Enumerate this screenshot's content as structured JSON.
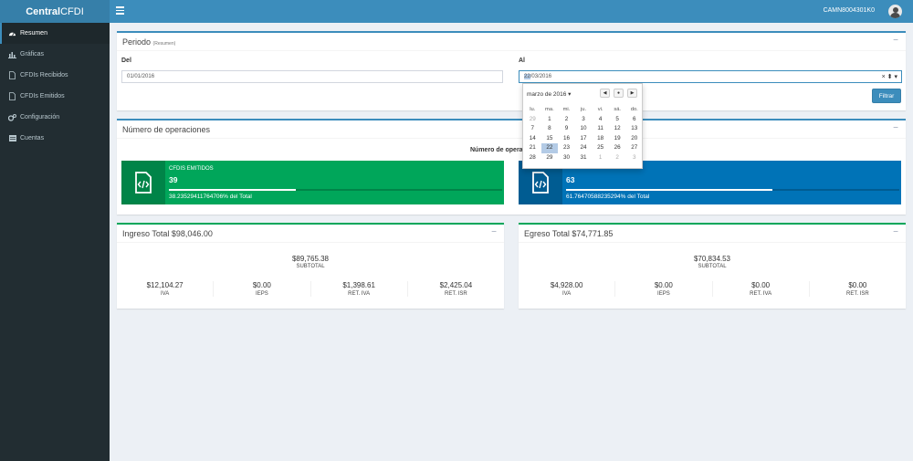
{
  "app": {
    "logo_bold": "Central",
    "logo_rest": "CFDI",
    "user": "CAMN8004301K0"
  },
  "sidebar": {
    "items": [
      {
        "label": "Resumen",
        "icon": "dashboard-icon"
      },
      {
        "label": "Gráficas",
        "icon": "bar-chart-icon"
      },
      {
        "label": "CFDIs Recibidos",
        "icon": "file-icon"
      },
      {
        "label": "CFDIs Emitidos",
        "icon": "file-icon"
      },
      {
        "label": "Configuración",
        "icon": "gears-icon"
      },
      {
        "label": "Cuentas",
        "icon": "list-icon"
      }
    ]
  },
  "periodo": {
    "title": "Periodo",
    "subtitle": "(Resumen)",
    "del_label": "Del",
    "del_value": "01/01/2016",
    "al_label": "Al",
    "al_day": "22",
    "al_rest": "/03/2016",
    "filter_button": "Filtrar"
  },
  "datepicker": {
    "month_label": "marzo de 2016 ▾",
    "weekdays": [
      "lu.",
      "ma.",
      "mi.",
      "ju.",
      "vi.",
      "sá.",
      "do."
    ],
    "weeks": [
      [
        "29",
        "1",
        "2",
        "3",
        "4",
        "5",
        "6"
      ],
      [
        "7",
        "8",
        "9",
        "10",
        "11",
        "12",
        "13"
      ],
      [
        "14",
        "15",
        "16",
        "17",
        "18",
        "19",
        "20"
      ],
      [
        "21",
        "22",
        "23",
        "24",
        "25",
        "26",
        "27"
      ],
      [
        "28",
        "29",
        "30",
        "31",
        "1",
        "2",
        "3"
      ]
    ],
    "selected": "22"
  },
  "operaciones": {
    "title": "Número de operaciones",
    "center_label": "Número de operaciones",
    "emitidos": {
      "title": "CFDIS EMITIDOS",
      "count": "39",
      "desc": "38.23529411764706% del Total",
      "progress": 0.382,
      "color": "#00a65a"
    },
    "recibidos": {
      "count": "63",
      "desc": "61.76470588235294% del Total",
      "progress": 0.618,
      "color": "#0073b7"
    }
  },
  "ingreso": {
    "title": "Ingreso Total $98,046.00",
    "subtotal": "$89,765.38",
    "subtotal_label": "SUBTOTAL",
    "items": [
      {
        "amount": "$12,104.27",
        "label": "IVA"
      },
      {
        "amount": "$0.00",
        "label": "IEPS"
      },
      {
        "amount": "$1,398.61",
        "label": "RET. IVA"
      },
      {
        "amount": "$2,425.04",
        "label": "RET. ISR"
      }
    ]
  },
  "egreso": {
    "title": "Egreso Total $74,771.85",
    "subtotal": "$70,834.53",
    "subtotal_label": "SUBTOTAL",
    "items": [
      {
        "amount": "$4,928.00",
        "label": "IVA"
      },
      {
        "amount": "$0.00",
        "label": "IEPS"
      },
      {
        "amount": "$0.00",
        "label": "RET. IVA"
      },
      {
        "amount": "$0.00",
        "label": "RET. ISR"
      }
    ]
  }
}
